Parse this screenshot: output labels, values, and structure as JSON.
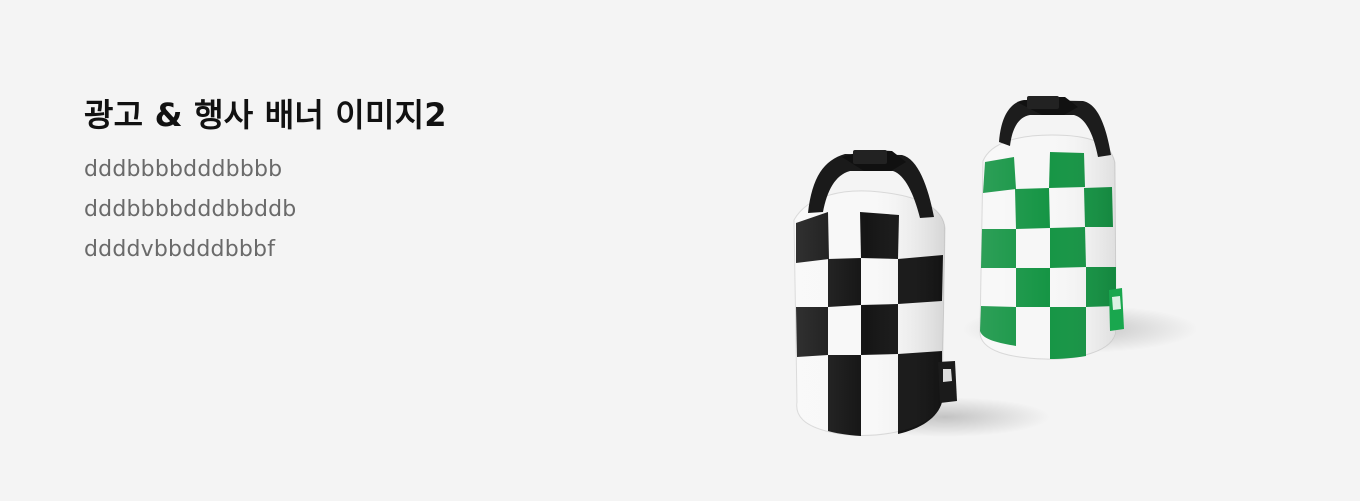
{
  "banner": {
    "title": "광고 & 행사 배너 이미지2",
    "lines": [
      "dddbbbbdddbbbb",
      "dddbbbbdddbbddb",
      "ddddvbbdddbbbf"
    ],
    "image": {
      "alt": "black and white checkered dry bag and green and white checkered dry bag"
    },
    "colors": {
      "background": "#f4f4f4",
      "title": "#111111",
      "text": "#6a6a6a",
      "black_check": "#151515",
      "green_check": "#159446"
    }
  }
}
